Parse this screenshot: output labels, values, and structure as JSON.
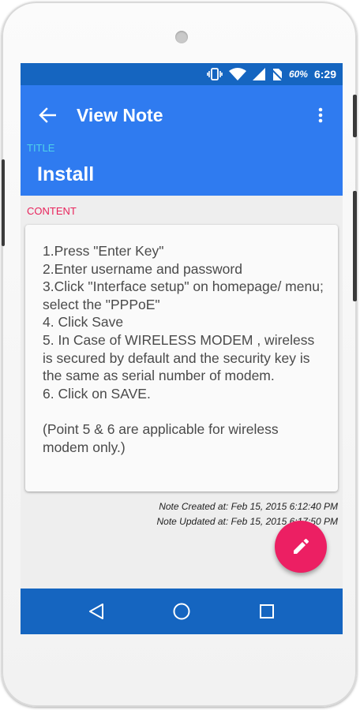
{
  "status_bar": {
    "battery_percent": "60%",
    "time": "6:29",
    "icons": [
      "vibrate-icon",
      "wifi-icon",
      "signal-icon",
      "no-sim-icon"
    ]
  },
  "app_bar": {
    "title": "View Note",
    "back_icon": "arrow-left-icon",
    "menu_icon": "more-vert-icon"
  },
  "note": {
    "title_label": "TITLE",
    "title": "Install",
    "content_label": "CONTENT",
    "content": "1.Press \"Enter Key\"\n2.Enter username and password\n3.Click \"Interface setup\" on homepage/ menu; select the \"PPPoE\"\n4. Click Save\n5. In Case of WIRELESS MODEM , wireless is secured by default and the security key is the same as serial number of modem.\n6. Click on SAVE.\n\n(Point 5 & 6 are applicable for wireless modem only.)",
    "created": "Note Created at:  Feb 15, 2015 6:12:40 PM",
    "updated": "Note Updated at: Feb 15, 2015 6:17:50 PM"
  },
  "fab": {
    "icon": "edit-pencil-icon"
  },
  "nav_bar": {
    "icons": [
      "nav-back-icon",
      "nav-home-icon",
      "nav-recent-icon"
    ]
  },
  "colors": {
    "status_bar": "#1565c0",
    "app_bar": "#2f7bf0",
    "title_label": "#4fd3e8",
    "content_label": "#e8245c",
    "fab": "#ec1f63",
    "nav_bar": "#1565c0"
  }
}
